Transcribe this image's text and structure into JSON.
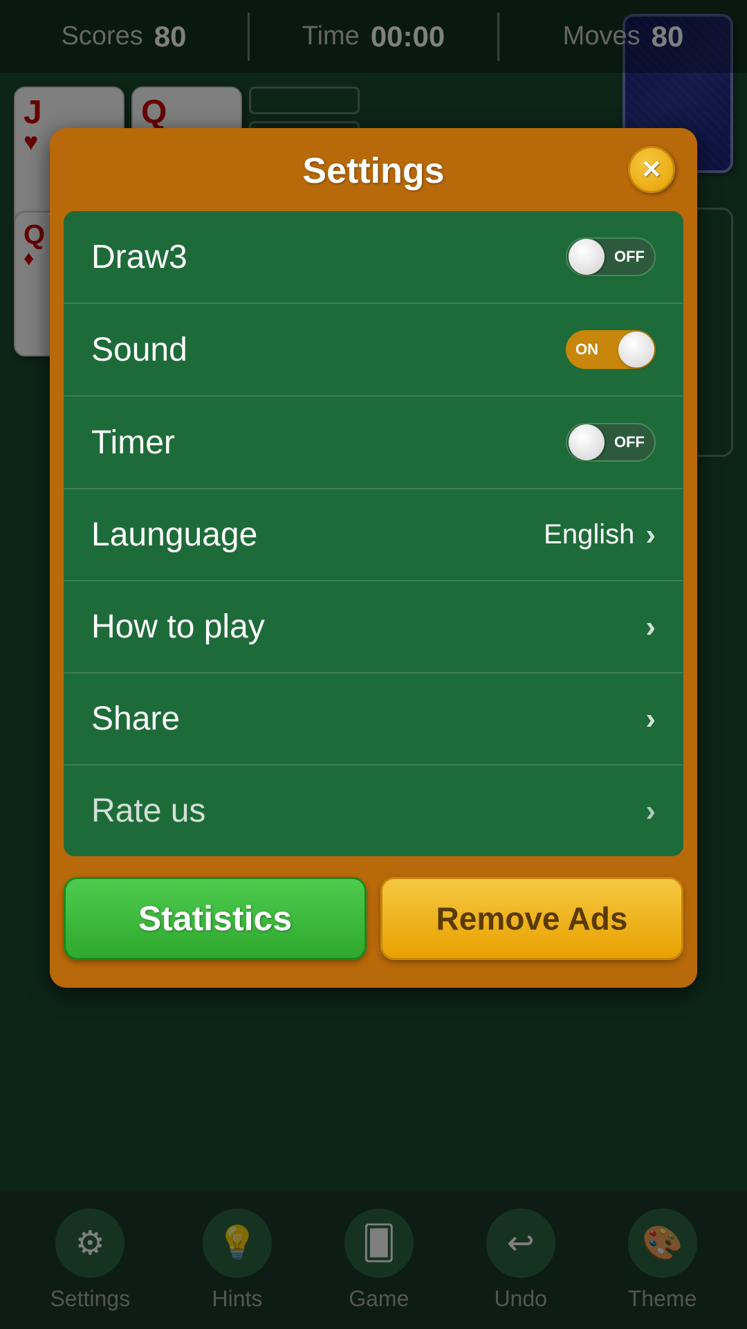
{
  "status": {
    "scores_label": "Scores",
    "scores_value": "80",
    "time_label": "Time",
    "time_value": "00:00",
    "moves_label": "Moves",
    "moves_value": "80"
  },
  "settings": {
    "title": "Settings",
    "close_label": "✕",
    "items": [
      {
        "id": "draw3",
        "label": "Draw3",
        "type": "toggle",
        "state": "off",
        "toggle_label": "OFF"
      },
      {
        "id": "sound",
        "label": "Sound",
        "type": "toggle",
        "state": "on",
        "toggle_label": "ON"
      },
      {
        "id": "timer",
        "label": "Timer",
        "type": "toggle",
        "state": "off",
        "toggle_label": "OFF"
      },
      {
        "id": "language",
        "label": "Launguage",
        "type": "link",
        "value": "English",
        "chevron": "›"
      },
      {
        "id": "how_to_play",
        "label": "How to play",
        "type": "link",
        "value": "",
        "chevron": "›"
      },
      {
        "id": "share",
        "label": "Share",
        "type": "link",
        "value": "",
        "chevron": "›"
      },
      {
        "id": "rate_us",
        "label": "Rate us",
        "type": "link",
        "value": "",
        "chevron": "›"
      }
    ],
    "btn_statistics": "Statistics",
    "btn_remove_ads": "Remove Ads"
  },
  "bottom_nav": [
    {
      "id": "settings",
      "icon": "⚙",
      "label": "Settings"
    },
    {
      "id": "hints",
      "icon": "💡",
      "label": "Hints"
    },
    {
      "id": "game",
      "icon": "🂠",
      "label": "Game"
    },
    {
      "id": "undo",
      "icon": "↩",
      "label": "Undo"
    },
    {
      "id": "theme",
      "icon": "🎨",
      "label": "Theme"
    }
  ],
  "cards": {
    "jack_hearts": {
      "rank": "J",
      "suit": "♥",
      "color": "red"
    },
    "queen_diamonds": {
      "rank": "Q",
      "suit": "♦",
      "color": "red"
    },
    "queen_diamonds2": {
      "rank": "Q",
      "suit": "♦",
      "color": "red"
    },
    "spades_placeholder": "♠"
  }
}
